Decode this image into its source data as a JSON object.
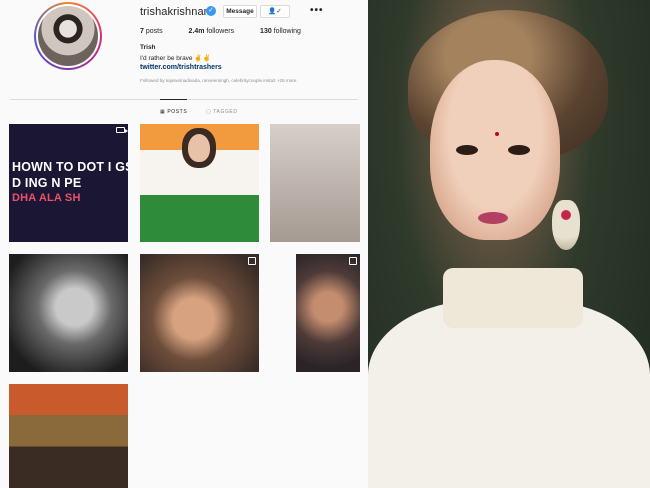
{
  "profile": {
    "username": "trishakrishnan",
    "verified_icon": "verified-badge-icon",
    "message_label": "Message",
    "follow_label": "👤✓",
    "more_label": "•••",
    "posts_count": "7",
    "posts_label": "posts",
    "followers_count": "2.4m",
    "followers_label": "followers",
    "following_count": "130",
    "following_label": "following",
    "bio_name": "Trish",
    "bio_text": "I'd rather be brave ✌️✌️",
    "bio_link": "twitter.com/trishtrashers",
    "followed_by": "Followed by tejaswimadivada, ranveersingh, celebritycouple.insta2 +26 more"
  },
  "tabs": {
    "posts_label": "POSTS",
    "tagged_label": "TAGGED"
  },
  "tiles": {
    "tile1": {
      "line1": "HOWN  TO DOT I GS",
      "line2": "D  ING N    PE",
      "line3": "DHA ALA SH"
    }
  },
  "colors": {
    "accent_link": "#003569",
    "verified": "#3897f0",
    "divider": "#dbdbdb"
  }
}
